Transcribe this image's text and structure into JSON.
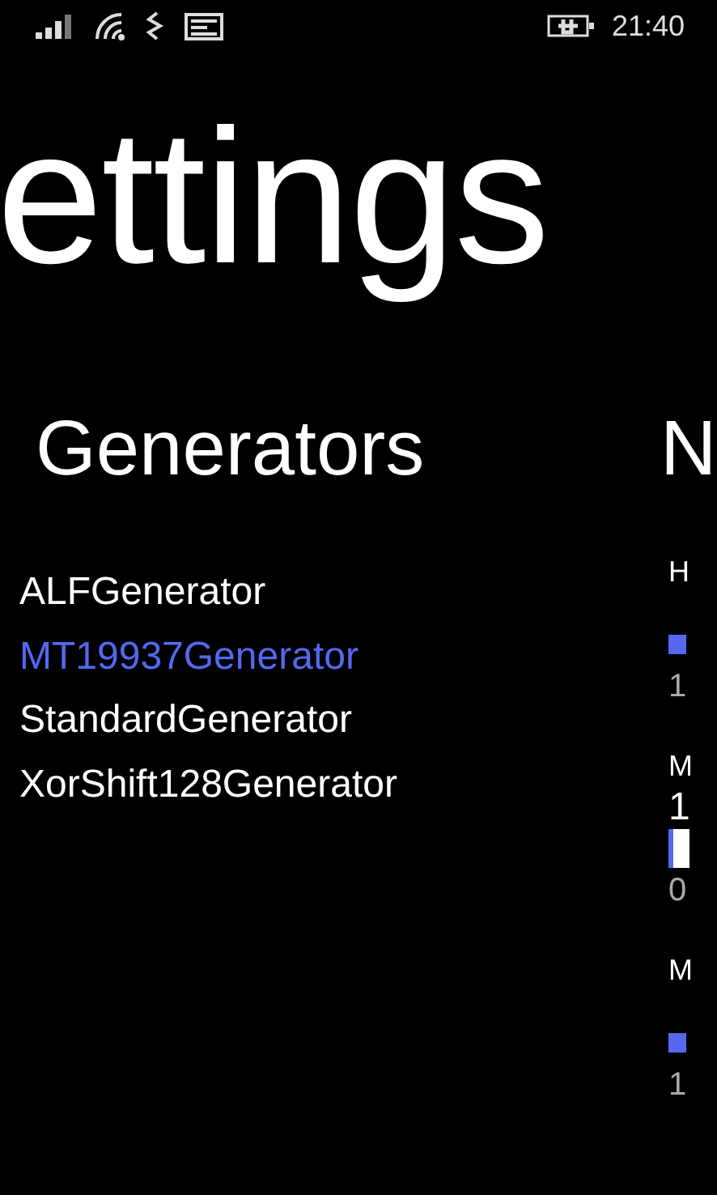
{
  "status_bar": {
    "time": "21:40"
  },
  "panorama": {
    "title": "ettings"
  },
  "generators": {
    "header": "Generators",
    "items": [
      {
        "label": "ALFGenerator",
        "selected": false
      },
      {
        "label": "MT19937Generator",
        "selected": true
      },
      {
        "label": "StandardGenerator",
        "selected": false
      },
      {
        "label": "XorShift128Generator",
        "selected": false
      }
    ]
  },
  "next_panel": {
    "header": "N",
    "settings": [
      {
        "label": "H",
        "dragging": false,
        "reading": "1"
      },
      {
        "label": "M",
        "dragging": true,
        "tooltip": "1",
        "reading": "0"
      },
      {
        "label": "M",
        "dragging": false,
        "reading": "1"
      }
    ]
  }
}
